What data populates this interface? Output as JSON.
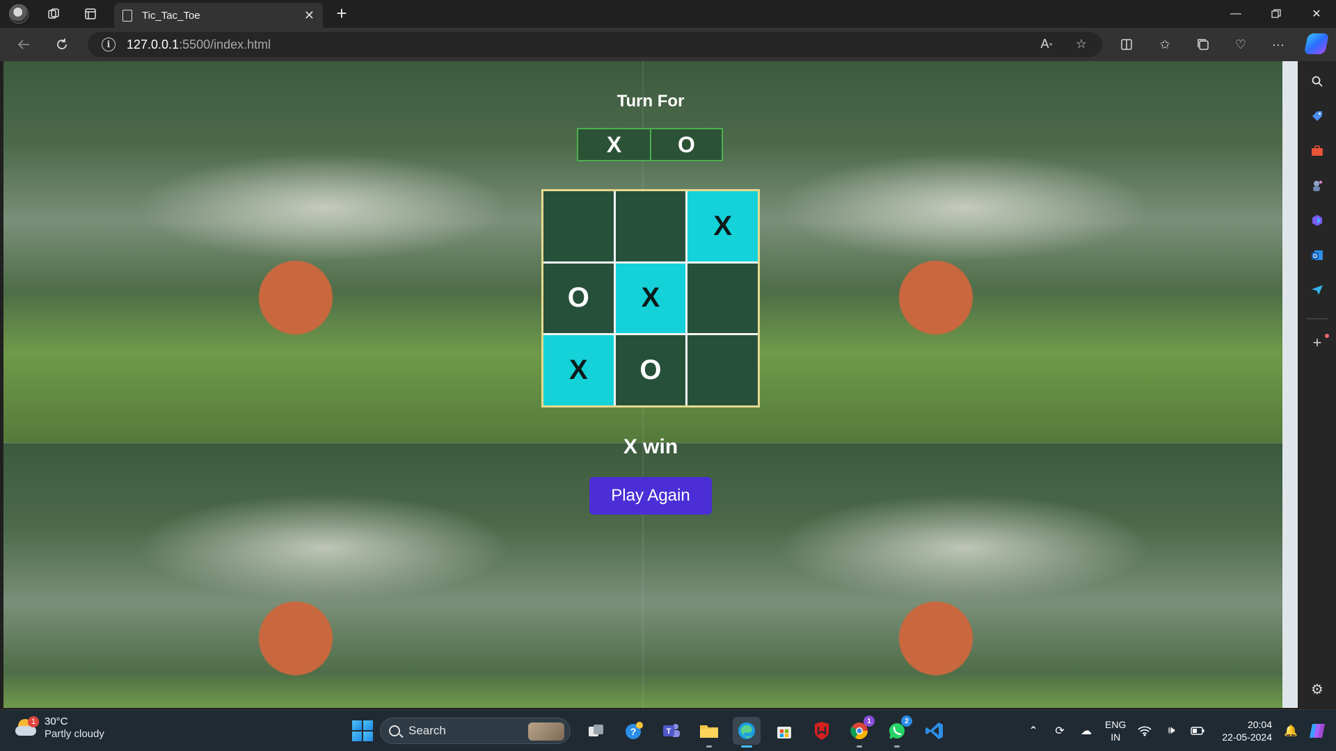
{
  "browser": {
    "tab_title": "Tic_Tac_Toe",
    "url_host": "127.0.0.1",
    "url_path": ":5500/index.html"
  },
  "game": {
    "turn_label": "Turn For",
    "turn_options": [
      "X",
      "O"
    ],
    "board": [
      {
        "mark": "",
        "win": false
      },
      {
        "mark": "",
        "win": false
      },
      {
        "mark": "X",
        "win": true
      },
      {
        "mark": "O",
        "win": false
      },
      {
        "mark": "X",
        "win": true
      },
      {
        "mark": "",
        "win": false
      },
      {
        "mark": "X",
        "win": true
      },
      {
        "mark": "O",
        "win": false
      },
      {
        "mark": "",
        "win": false
      }
    ],
    "result": "X win",
    "play_again_label": "Play Again"
  },
  "taskbar": {
    "weather_temp": "30°C",
    "weather_desc": "Partly cloudy",
    "weather_badge": "1",
    "search_label": "Search",
    "chrome_badge": "1",
    "whatsapp_badge": "2",
    "language": "ENG",
    "region": "IN",
    "time": "20:04",
    "date": "22-05-2024"
  },
  "colors": {
    "board_cell": "#27503a",
    "win_cell": "#14d2d8",
    "play_again": "#4b2ed6",
    "board_border": "#e6d98f",
    "turn_border": "#4caf50"
  }
}
